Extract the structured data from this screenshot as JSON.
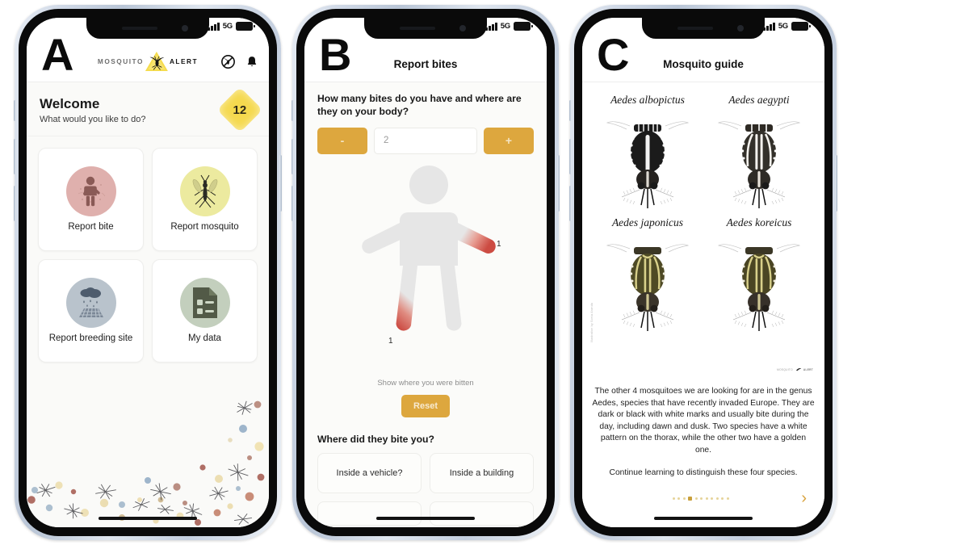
{
  "status_bar": {
    "network": "5G",
    "signal_bars": 4,
    "battery_full": true
  },
  "phones": [
    {
      "letter": "A",
      "header": {
        "logo_word_1": "MOSQUITO",
        "logo_word_2": "ALERT",
        "icons": [
          "no-mosquito-icon",
          "notification-bell-icon"
        ]
      },
      "welcome": {
        "title": "Welcome",
        "subtitle": "What would you like to do?",
        "badge_count": "12"
      },
      "cards": [
        {
          "label": "Report bite",
          "icon": "person-bitten-icon",
          "circle_color": "#dfb0ad"
        },
        {
          "label": "Report mosquito",
          "icon": "mosquito-icon",
          "circle_color": "#ecea9f"
        },
        {
          "label": "Report breeding site",
          "icon": "rain-drain-icon",
          "circle_color": "#b9c3cc"
        },
        {
          "label": "My data",
          "icon": "document-list-icon",
          "circle_color": "#c3cfbd"
        }
      ]
    },
    {
      "letter": "B",
      "header": {
        "title": "Report bites"
      },
      "question_1": "How many bites do you have and where are they on your body?",
      "stepper": {
        "decrement_label": "-",
        "increment_label": "+",
        "value": "2"
      },
      "body_map": {
        "caption": "Show where you were bitten",
        "reset_label": "Reset",
        "markers": [
          {
            "location": "right-forearm",
            "count": "1"
          },
          {
            "location": "left-lower-leg",
            "count": "1"
          }
        ]
      },
      "question_2": "Where did they bite you?",
      "options": [
        "Inside a vehicle?",
        "Inside a building"
      ]
    },
    {
      "letter": "C",
      "header": {
        "title": "Mosquito guide"
      },
      "species": [
        {
          "name": "Aedes albopictus",
          "pattern": "white-stripe"
        },
        {
          "name": "Aedes aegypti",
          "pattern": "white-lyre"
        },
        {
          "name": "Aedes japonicus",
          "pattern": "golden-lyre"
        },
        {
          "name": "Aedes koreicus",
          "pattern": "golden-lyre"
        }
      ],
      "credit_vertical": "Illustration by Sonia Aranda",
      "credit_logo": {
        "word_1": "MOSQUITO",
        "word_2": "ALERT"
      },
      "paragraphs": [
        "The other 4 mosquitoes we are looking for are in the genus Aedes, species that have recently invaded Europe. They are dark or black with white marks and usually bite during the day, including dawn and dusk. Two species have a white pattern on the thorax, while the other two have a golden one.",
        "Continue learning to distinguish these four species."
      ],
      "pagination": {
        "total": 11,
        "active_index": 3
      },
      "next_label": "›"
    }
  ],
  "colors": {
    "accent_amber": "#dda73e",
    "brand_yellow": "#f5d94e",
    "pager_active": "#c9a03c",
    "bite_red": "#d9534f"
  }
}
